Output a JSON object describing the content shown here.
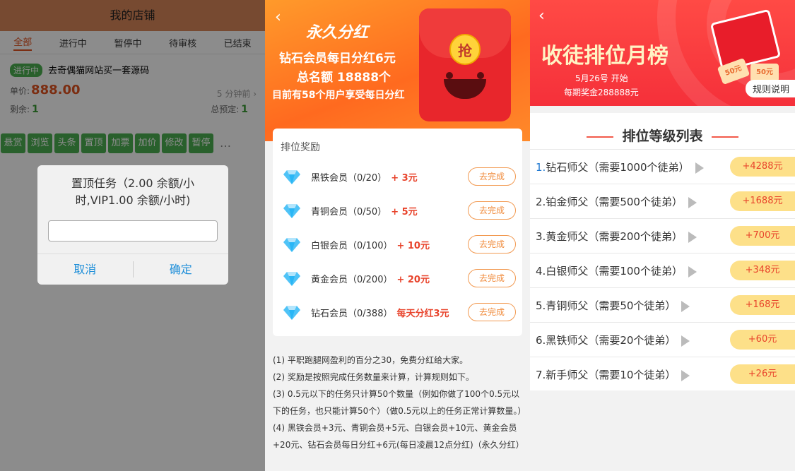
{
  "shop": {
    "title": "我的店铺",
    "tabs": [
      "全部",
      "进行中",
      "暂停中",
      "待审核",
      "已结束"
    ],
    "active_tab": "全部",
    "task": {
      "status": "进行中",
      "name": "去奇偶猫网站买一套源码",
      "price_label": "单价:",
      "price": "888.00",
      "time_ago": "5 分钟前",
      "remaining_label": "剩余:",
      "remaining": "1",
      "total_label": "总预定:",
      "total": "1"
    },
    "actions": [
      "悬赏",
      "浏览",
      "头条",
      "置顶",
      "加票",
      "加价",
      "修改",
      "暂停"
    ],
    "more": "…",
    "dialog": {
      "title": "置顶任务（2.00 余额/小时,VIP1.00 余额/小时)",
      "input_value": "",
      "cancel": "取消",
      "confirm": "确定"
    }
  },
  "dividend": {
    "banner": {
      "headline": "永久分红",
      "line1": "钻石会员每日分红6元",
      "line2": "总名额 18888个",
      "line3": "目前有58个用户享受每日分红",
      "envelope_char": "抢"
    },
    "card_title": "排位奖励",
    "go_label": "去完成",
    "rewards": [
      {
        "name": "黑铁会员（0/20）",
        "reward": "+ 3元"
      },
      {
        "name": "青铜会员（0/50）",
        "reward": "+ 5元"
      },
      {
        "name": "白银会员（0/100）",
        "reward": "+ 10元"
      },
      {
        "name": "黄金会员（0/200）",
        "reward": "+ 20元"
      },
      {
        "name": "钻石会员（0/388）",
        "reward": "每天分红3元"
      }
    ],
    "rules": [
      "(1) 平职跑腿网盈利的百分之30，免费分红给大家。",
      "(2) 奖励是按照完成任务数量来计算，计算规则如下。",
      "(3) 0.5元以下的任务只计算50个数量（例如你做了100个0.5元以下的任务，也只能计算50个）（做0.5元以上的任务正常计算数量。）",
      "(4) 黑铁会员+3元、青铜会员+5元、白银会员+10元、黄金会员+20元、钻石会员每日分红+6元(每日凌晨12点分红)（永久分红）"
    ],
    "colors": {
      "accent": "#ff6a1f",
      "reward": "#e8432b"
    }
  },
  "ranking": {
    "banner": {
      "title": "收徒排位月榜",
      "start": "5月26号 开始",
      "prize": "每期奖金288888元",
      "rules_button": "规则说明",
      "coupon": "50元"
    },
    "list_title": "排位等级列表",
    "items": [
      {
        "idx": "1.",
        "label": "钻石师父（需要1000个徒弟）",
        "amount": "+4288元"
      },
      {
        "idx": "2.",
        "label": "铂金师父（需要500个徒弟）",
        "amount": "+1688元"
      },
      {
        "idx": "3.",
        "label": "黄金师父（需要200个徒弟）",
        "amount": "+700元"
      },
      {
        "idx": "4.",
        "label": "白银师父（需要100个徒弟）",
        "amount": "+348元"
      },
      {
        "idx": "5.",
        "label": "青铜师父（需要50个徒弟）",
        "amount": "+168元"
      },
      {
        "idx": "6.",
        "label": "黑铁师父（需要20个徒弟）",
        "amount": "+60元"
      },
      {
        "idx": "7.",
        "label": "新手师父（需要10个徒弟）",
        "amount": "+26元"
      }
    ],
    "colors": {
      "banner": "#f5303a",
      "amount_bg": "#fde089"
    }
  }
}
